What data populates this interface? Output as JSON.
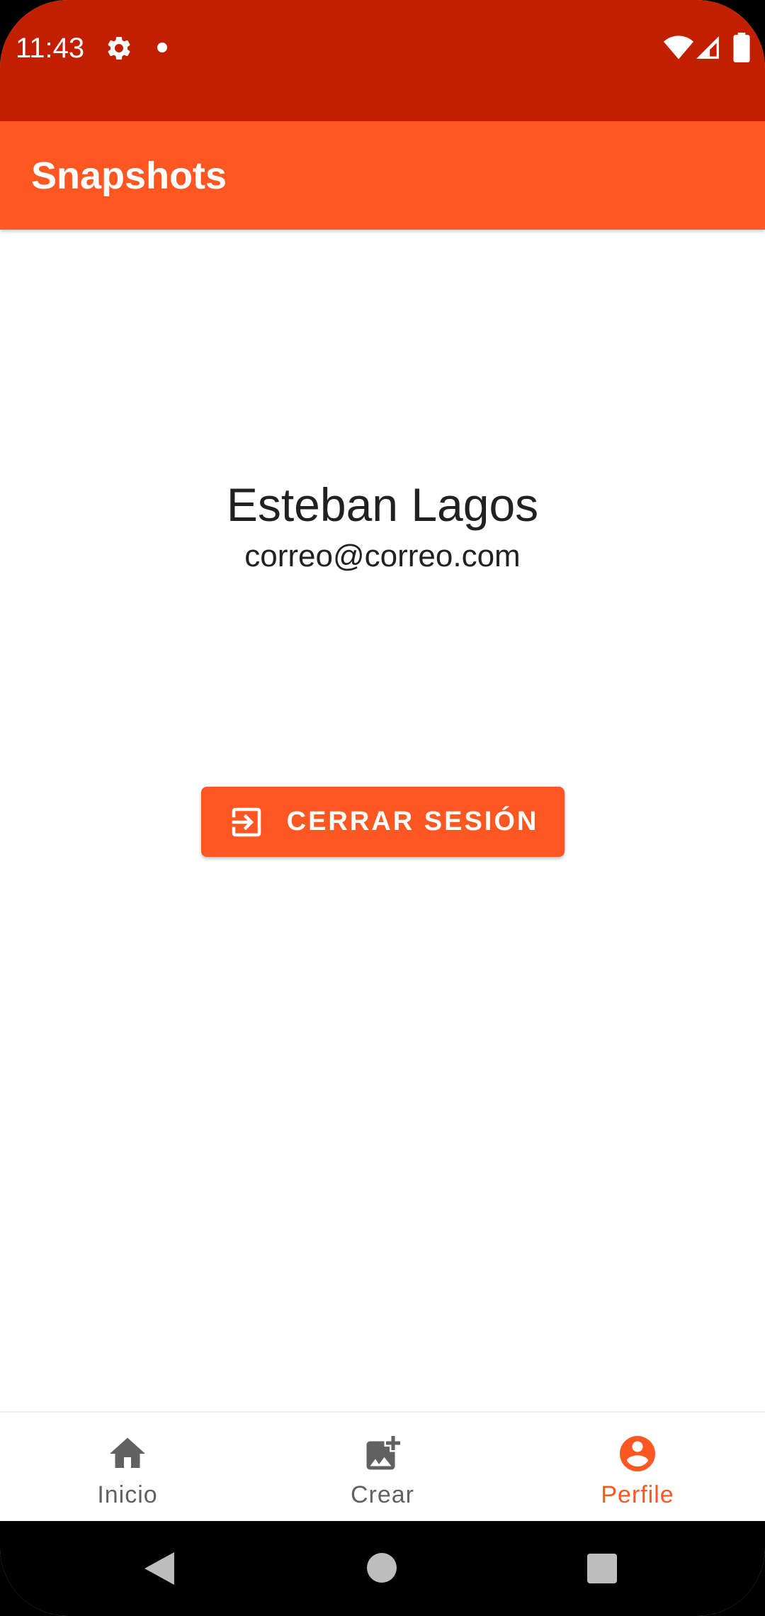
{
  "status_bar": {
    "time": "11:43",
    "background_color": "#c21e00",
    "icons": [
      "settings-icon",
      "notification-dot-icon",
      "wifi-icon",
      "signal-icon",
      "battery-icon"
    ]
  },
  "app_bar": {
    "title": "Snapshots",
    "background_color": "#ff5722"
  },
  "profile": {
    "name": "Esteban Lagos",
    "email": "correo@correo.com"
  },
  "logout_button": {
    "label": "CERRAR SESIÓN",
    "icon": "logout-icon",
    "background_color": "#ff5722"
  },
  "bottom_nav": {
    "active_color": "#ff5722",
    "inactive_color": "#616161",
    "items": [
      {
        "label": "Inicio",
        "icon": "home-icon",
        "active": false
      },
      {
        "label": "Crear",
        "icon": "add-photo-icon",
        "active": false
      },
      {
        "label": "Perfile",
        "icon": "account-circle-icon",
        "active": true
      }
    ]
  },
  "system_nav": {
    "icons": [
      "back-icon",
      "home-circle-icon",
      "recents-icon"
    ]
  }
}
